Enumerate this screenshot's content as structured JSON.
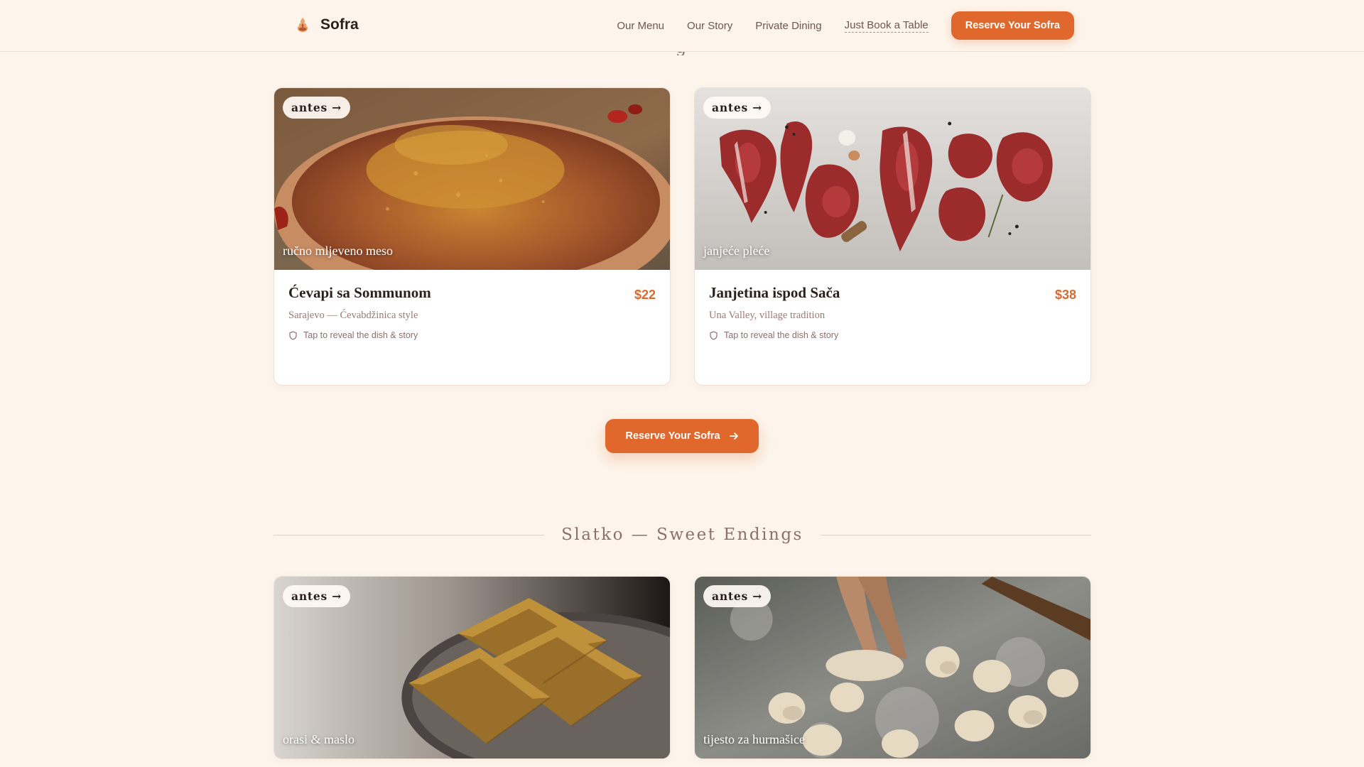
{
  "header": {
    "brand_name": "Sofra",
    "brand_icon": "flame-pot-icon",
    "nav": [
      "Our Menu",
      "Our Story",
      "Private Dining",
      "Just Book a Table"
    ],
    "cta_label": "Reserve Your Sofra"
  },
  "peek_heading": "g",
  "cards_top": [
    {
      "badge": "antes →",
      "photo_caption": "ručno mljeveno meso",
      "name": "Ćevapi sa Sommunom",
      "price": "$22",
      "origin": "Sarajevo — Ćevabdžinica style",
      "reveal": "Tap to reveal the dish & story"
    },
    {
      "badge": "antes →",
      "photo_caption": "janjeće pleće",
      "name": "Janjetina ispod Sača",
      "price": "$38",
      "origin": "Una Valley, village tradition",
      "reveal": "Tap to reveal the dish & story"
    }
  ],
  "center_cta_label": "Reserve Your Sofra",
  "section_heading": "Slatko — Sweet Endings",
  "cards_bottom": [
    {
      "badge": "antes →",
      "photo_caption": "orasi & maslo"
    },
    {
      "badge": "antes →",
      "photo_caption": "tijesto za hurmašice"
    }
  ],
  "colors": {
    "background": "#fdf5ec",
    "accent": "#e0682c",
    "price": "#d9692c",
    "muted": "#8a6f6b"
  }
}
